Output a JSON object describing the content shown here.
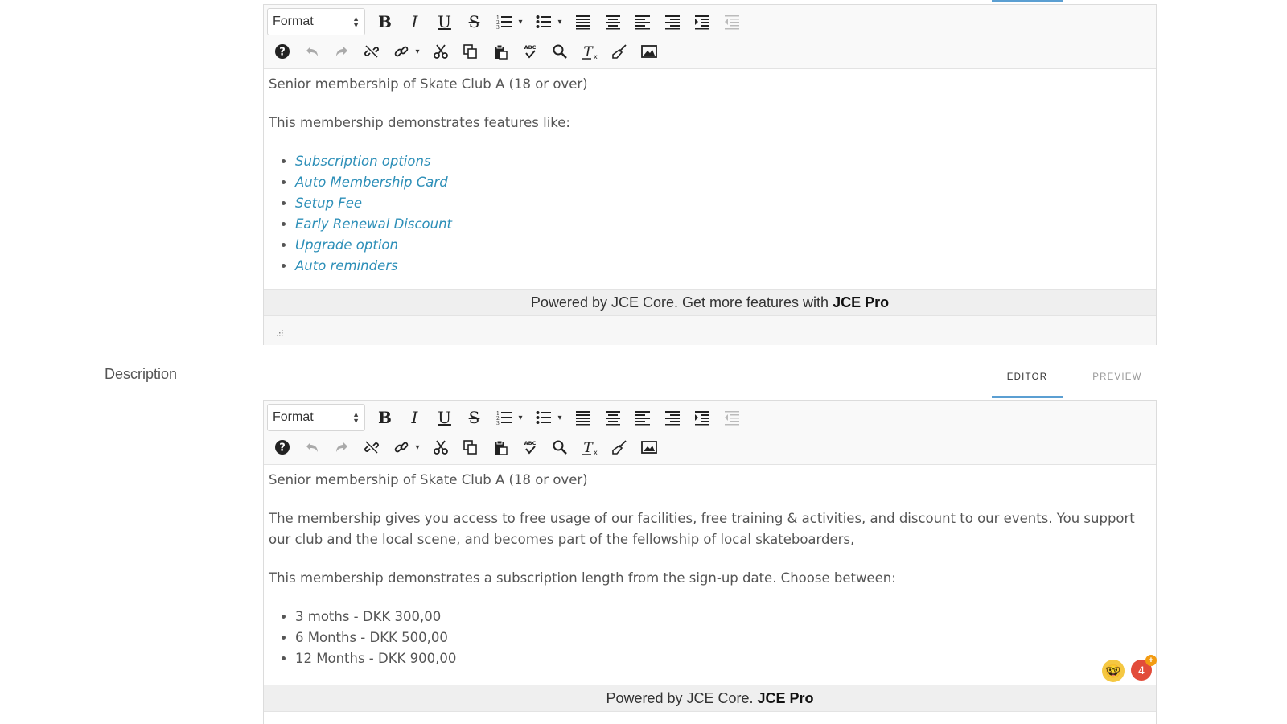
{
  "toolbar": {
    "format_label": "Format",
    "format_arrows": "▲▼",
    "row1": [
      {
        "name": "bold-button",
        "glyph": "B"
      },
      {
        "name": "italic-button",
        "glyph": "I"
      },
      {
        "name": "underline-button",
        "glyph": "U"
      },
      {
        "name": "strikethrough-button",
        "glyph": "S"
      },
      {
        "name": "ordered-list-button",
        "glyph": "☰"
      },
      {
        "name": "unordered-list-button",
        "glyph": "☰"
      },
      {
        "name": "justify-button",
        "glyph": "≡"
      },
      {
        "name": "align-center-button",
        "glyph": "≡"
      },
      {
        "name": "align-left-button",
        "glyph": "≡"
      },
      {
        "name": "align-right-button",
        "glyph": "≡"
      },
      {
        "name": "indent-button",
        "glyph": "⇥"
      },
      {
        "name": "outdent-button",
        "glyph": "⇤"
      }
    ],
    "caret": "▾",
    "spellcheck_label": "ABC"
  },
  "editor1": {
    "title": "Senior membership of Skate Club A (18 or over)",
    "intro": "This membership demonstrates features like:",
    "features": [
      "Subscription options",
      "Auto Membership Card",
      "Setup Fee",
      "Early Renewal Discount",
      "Upgrade option",
      "Auto reminders"
    ],
    "powered_prefix": "Powered by JCE Core. Get more features with ",
    "powered_brand": "JCE Pro"
  },
  "description": {
    "label": "Description",
    "tab_editor": "EDITOR",
    "tab_preview": "PREVIEW"
  },
  "editor2": {
    "title": "Senior membership of Skate Club A (18 or over)",
    "paragraph": "The membership gives you access to free usage of our facilities, free training & activities, and discount to our events.  You support our club and the local scene, and becomes part of the fellowship of local skateboarders,",
    "intro": "This membership demonstrates a subscription length from the sign-up date. Choose between:",
    "options": [
      "3 moths - DKK 300,00",
      "6 Months - DKK 500,00",
      "12 Months - DKK 900,00"
    ],
    "powered_prefix": "Powered by JCE Core. ",
    "powered_brand": "JCE Pro"
  },
  "floating": {
    "emoji": "🤓",
    "badge_count": "4",
    "badge_plus": "+"
  },
  "colors": {
    "accent": "#5b9fd2",
    "link": "#2d8fb8",
    "badge": "#e24c3a"
  }
}
